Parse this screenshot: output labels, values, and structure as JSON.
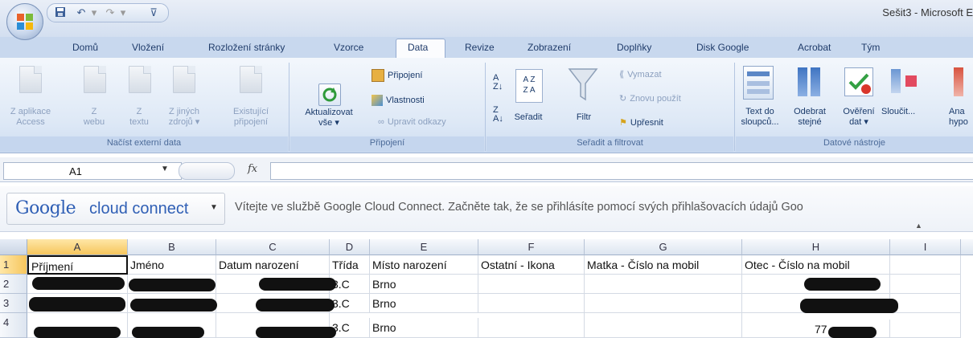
{
  "window": {
    "title": "Sešit3 - Microsoft E"
  },
  "tabs": [
    "Domů",
    "Vložení",
    "Rozložení stránky",
    "Vzorce",
    "Data",
    "Revize",
    "Zobrazení",
    "Doplňky",
    "Disk Google",
    "Acrobat",
    "Tým"
  ],
  "active_tab": "Data",
  "ribbon": {
    "external_data": {
      "label": "Načíst externí data",
      "buttons": [
        {
          "line1": "Z aplikace",
          "line2": "Access"
        },
        {
          "line1": "Z",
          "line2": "webu"
        },
        {
          "line1": "Z",
          "line2": "textu"
        },
        {
          "line1": "Z jiných",
          "line2": "zdrojů ▾"
        },
        {
          "line1": "Existující",
          "line2": "připojení"
        }
      ]
    },
    "connections": {
      "label": "Připojení",
      "refresh_line1": "Aktualizovat",
      "refresh_line2": "vše ▾",
      "connections": "Připojení",
      "properties": "Vlastnosti",
      "edit_links": "Upravit odkazy"
    },
    "sort_filter": {
      "label": "Seřadit a filtrovat",
      "sort": "Seřadit",
      "filter": "Filtr",
      "clear": "Vymazat",
      "reapply": "Znovu použít",
      "advanced": "Upřesnit"
    },
    "data_tools": {
      "label": "Datové nástroje",
      "buttons": [
        {
          "line1": "Text do",
          "line2": "sloupců..."
        },
        {
          "line1": "Odebrat",
          "line2": "stejné"
        },
        {
          "line1": "Ověření",
          "line2": "dat ▾"
        },
        {
          "line1": "Sloučit...",
          "line2": ""
        },
        {
          "line1": "Ana",
          "line2": "hypo"
        }
      ]
    }
  },
  "formula_bar": {
    "name_box": "A1",
    "fx": "fx",
    "formula": ""
  },
  "google_bar": {
    "brand": "Google",
    "product": "cloud connect",
    "message": "Vítejte ve službě Google Cloud Connect. Začněte tak, že se přihlásíte pomocí svých přihlašovacích údajů Goo"
  },
  "sheet": {
    "columns": [
      "A",
      "B",
      "C",
      "D",
      "E",
      "F",
      "G",
      "H",
      "I"
    ],
    "row_numbers": [
      "1",
      "2",
      "3",
      "4"
    ],
    "header_row": [
      "Příjmení",
      "Jméno",
      "Datum narození",
      "Třída",
      "Místo narození",
      "Ostatní - Ikona",
      "Matka - Číslo na mobil",
      "Otec - Číslo na mobil",
      ""
    ],
    "rows": [
      [
        "",
        "",
        "",
        "3.C",
        "Brno",
        "",
        "",
        "",
        ""
      ],
      [
        "",
        "",
        "",
        "3.C",
        "Brno",
        "",
        "",
        "",
        ""
      ],
      [
        "",
        "",
        "",
        "3.C",
        "Brno",
        "",
        "",
        "77",
        ""
      ]
    ],
    "selected_cell": "A1"
  },
  "colors": {
    "accent": "#f6c65d",
    "ribbon": "#dde8f6",
    "tab_text": "#1f3b6a"
  }
}
